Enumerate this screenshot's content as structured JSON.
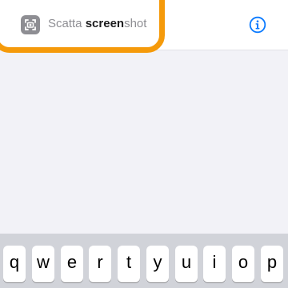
{
  "suggestion": {
    "text_prefix": "Scatta ",
    "text_match": "screen",
    "text_suffix": "shot",
    "icon": "screenshot-shortcut-icon",
    "info_icon": "info-circle-icon"
  },
  "highlight_color": "#f59a0a",
  "accent_color": "#0a7aff",
  "keyboard": {
    "row1": [
      "q",
      "w",
      "e",
      "r",
      "t",
      "y",
      "u",
      "i",
      "o",
      "p"
    ]
  }
}
